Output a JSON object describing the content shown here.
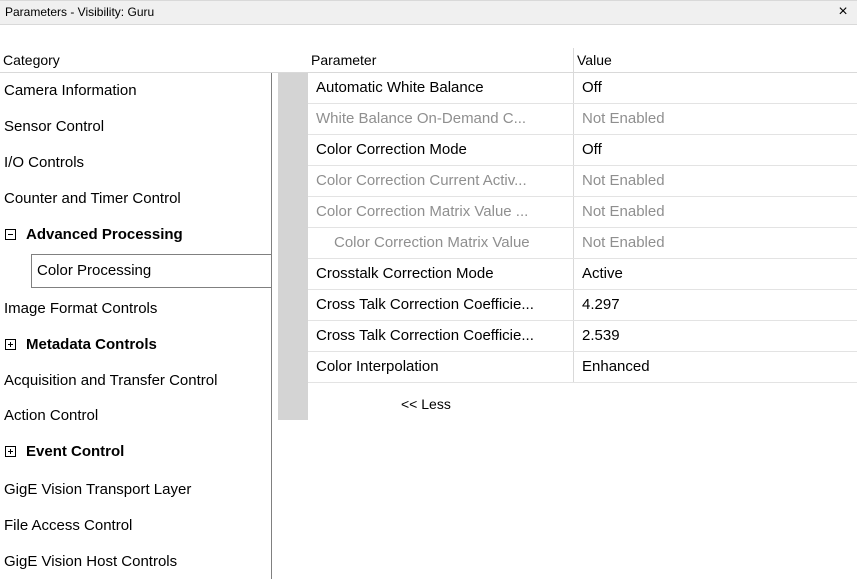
{
  "window": {
    "title": "Parameters - Visibility: Guru",
    "close_glyph": "×"
  },
  "headers": {
    "category": "Category",
    "parameter": "Parameter",
    "value": "Value"
  },
  "categories": [
    {
      "label": "Camera Information",
      "bold": false,
      "expander": null
    },
    {
      "label": "Sensor Control",
      "bold": false,
      "expander": null
    },
    {
      "label": "I/O Controls",
      "bold": false,
      "expander": null
    },
    {
      "label": "Counter and Timer Control",
      "bold": false,
      "expander": null
    },
    {
      "label": "Advanced Processing",
      "bold": true,
      "expander": "collapse"
    },
    {
      "label": "Color Processing",
      "bold": false,
      "expander": null,
      "selected": true
    },
    {
      "label": "Image Format Controls",
      "bold": false,
      "expander": null
    },
    {
      "label": "Metadata Controls",
      "bold": true,
      "expander": "expand"
    },
    {
      "label": "Acquisition and Transfer Control",
      "bold": false,
      "expander": null
    },
    {
      "label": "Action Control",
      "bold": false,
      "expander": null
    },
    {
      "label": "Event Control",
      "bold": true,
      "expander": "expand"
    },
    {
      "label": "GigE Vision Transport Layer",
      "bold": false,
      "expander": null
    },
    {
      "label": "File Access Control",
      "bold": false,
      "expander": null
    },
    {
      "label": "GigE Vision Host Controls",
      "bold": false,
      "expander": null
    }
  ],
  "parameters": [
    {
      "name": "Automatic White Balance",
      "value": "Off",
      "enabled": true
    },
    {
      "name": "White Balance On-Demand C...",
      "value": "Not Enabled",
      "enabled": false
    },
    {
      "name": "Color Correction Mode",
      "value": "Off",
      "enabled": true
    },
    {
      "name": "Color Correction Current Activ...",
      "value": "Not Enabled",
      "enabled": false
    },
    {
      "name": "Color Correction Matrix Value ...",
      "value": "Not Enabled",
      "enabled": false
    },
    {
      "name": "Color Correction Matrix Value",
      "value": "Not Enabled",
      "enabled": false,
      "indent": true
    },
    {
      "name": "Crosstalk Correction Mode",
      "value": "Active",
      "enabled": true
    },
    {
      "name": "Cross Talk Correction Coefficie...",
      "value": "4.297",
      "enabled": true
    },
    {
      "name": "Cross Talk Correction Coefficie...",
      "value": "2.539",
      "enabled": true
    },
    {
      "name": "Color Interpolation",
      "value": "Enhanced",
      "enabled": true
    }
  ],
  "less_link": "<< Less"
}
